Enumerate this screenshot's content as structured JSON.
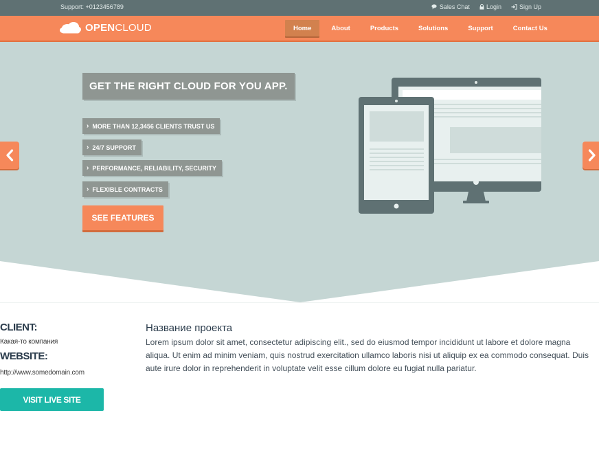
{
  "topbar": {
    "support_text": "Support: +0123456789",
    "links": [
      {
        "label": "Sales Chat",
        "icon": "chat-icon"
      },
      {
        "label": "Login",
        "icon": "lock-icon"
      },
      {
        "label": "Sign Up",
        "icon": "sign-in-icon"
      }
    ]
  },
  "brand": {
    "logo_icon": "cloud-icon",
    "name_bold": "OPEN",
    "name_light": "CLOUD"
  },
  "nav": {
    "items": [
      {
        "label": "Home",
        "active": true
      },
      {
        "label": "About",
        "active": false
      },
      {
        "label": "Products",
        "active": false
      },
      {
        "label": "Solutions",
        "active": false
      },
      {
        "label": "Support",
        "active": false
      },
      {
        "label": "Contact Us",
        "active": false
      }
    ]
  },
  "hero": {
    "headline": "GET THE RIGHT CLOUD FOR YOU APP.",
    "features": [
      "MORE THAN 12,3456 CLIENTS TRUST US",
      "24/7 SUPPORT",
      "PERFORMANCE, RELIABILITY, SECURITY",
      "FLEXIBLE CONTRACTS"
    ],
    "cta_label": "SEE FEATURES",
    "prev_icon": "chevron-left-icon",
    "next_icon": "chevron-right-icon",
    "illustration": "tablet-and-monitor-icon"
  },
  "project": {
    "client_label": "CLIENT:",
    "client_value": "Какая-то компания",
    "website_label": "WEBSITE:",
    "website_value": "http://www.somedomain.com",
    "visit_label": "VISIT LIVE SITE",
    "title": "Название проекта",
    "description": "Lorem ipsum dolor sit amet, consectetur adipiscing elit., sed do eiusmod tempor incididunt ut labore et dolore magna aliqua. Ut enim ad minim veniam, quis nostrud exercitation ullamco laboris nisi ut aliquip ex ea commodo consequat. Duis aute irure dolor in reprehenderit in voluptate velit esse cillum dolore eu fugiat nulla pariatur."
  },
  "colors": {
    "topbar": "#5f7173",
    "accent_orange": "#f6885a",
    "hero_bg": "#c5d6d4",
    "label_gray": "#8f9692",
    "teal_button": "#1cb7a8",
    "heading_navy": "#2a3b4b"
  }
}
